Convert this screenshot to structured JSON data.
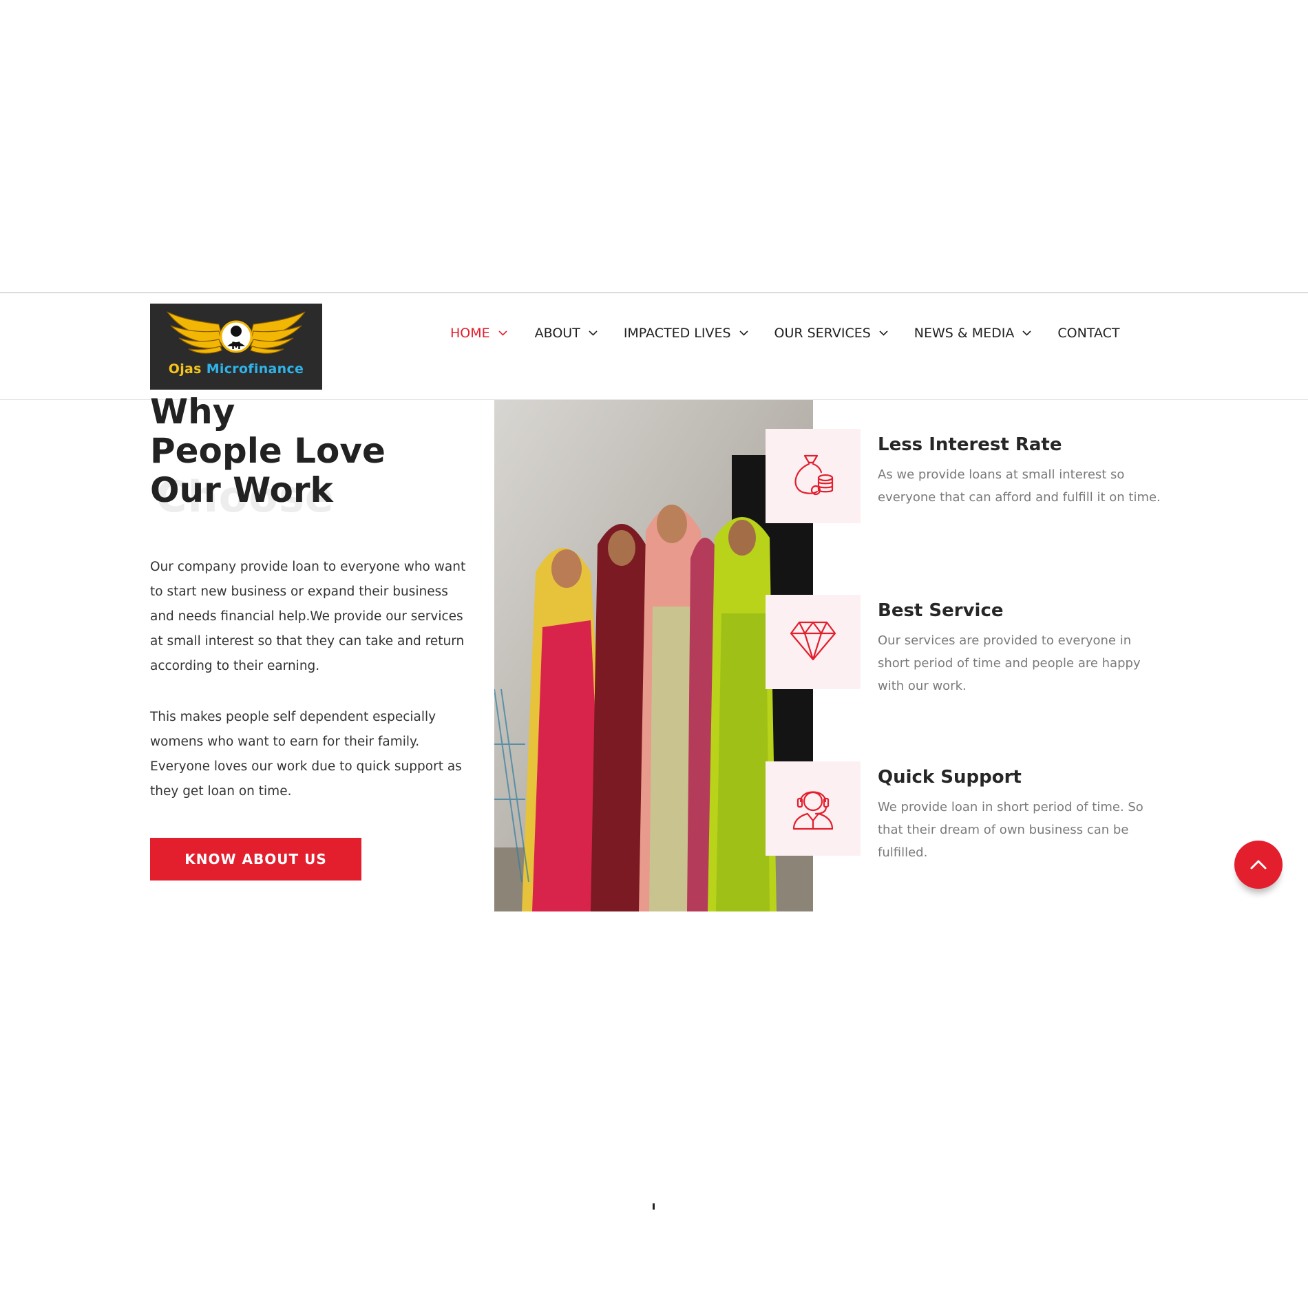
{
  "brand": {
    "logo_word1": "Ojas",
    "logo_word2": "Microfinance",
    "logo_alt": "Ojas Microfinance"
  },
  "nav": {
    "items": [
      {
        "label": "HOME",
        "has_dropdown": true,
        "active": true
      },
      {
        "label": "ABOUT",
        "has_dropdown": true,
        "active": false
      },
      {
        "label": "IMPACTED LIVES",
        "has_dropdown": true,
        "active": false
      },
      {
        "label": "OUR SERVICES",
        "has_dropdown": true,
        "active": false
      },
      {
        "label": "NEWS & MEDIA",
        "has_dropdown": true,
        "active": false
      },
      {
        "label": "CONTACT",
        "has_dropdown": false,
        "active": false
      }
    ]
  },
  "intro": {
    "heading_line1": "Why",
    "heading_line2": "People Love",
    "heading_line3": "Our Work",
    "ghost_text": "Choose",
    "paragraph1": "Our company provide loan to everyone who want to start new business or expand their business and needs financial help.We provide our services at small interest so that they can take and return according to their earning.",
    "paragraph2": "This makes people self dependent especially womens who want to earn for their family. Everyone loves our work due to quick support as they get loan on time.",
    "cta_label": "KNOW ABOUT US"
  },
  "features": [
    {
      "icon": "money-bag-coins-icon",
      "title": "Less Interest Rate",
      "text": "As we provide loans at small interest so everyone that can afford and fulfill it on time."
    },
    {
      "icon": "diamond-icon",
      "title": "Best Service",
      "text": "Our services are provided to everyone in short period of time and people are happy with our work."
    },
    {
      "icon": "headset-support-icon",
      "title": "Quick Support",
      "text": "We provide loan in short period of time. So that their dream of own business can be fulfilled."
    }
  ],
  "colors": {
    "accent": "#e31e2d",
    "icon_bg": "#fcf0f2",
    "text_dark": "#222222",
    "text_muted": "#7a7a7a"
  }
}
